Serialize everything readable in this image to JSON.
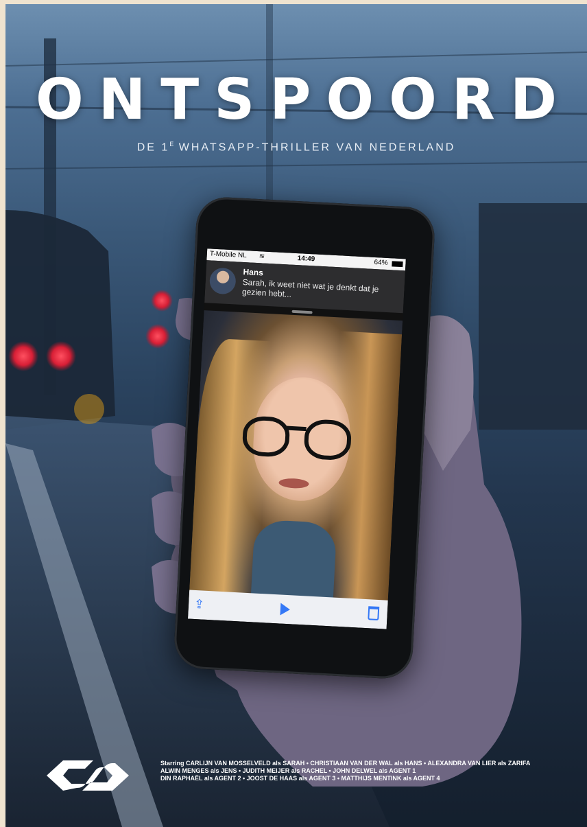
{
  "poster": {
    "title": "ONTSPOORD",
    "tagline_pre": "DE 1",
    "tagline_sup": "E",
    "tagline_post": " WHATSAPP-THRILLER VAN NEDERLAND",
    "colors": {
      "sky": "#4d6f93",
      "title": "#ffffff",
      "accent": "#3478f6",
      "signal_light": "#ff3b47"
    }
  },
  "phone": {
    "status": {
      "carrier": "T-Mobile NL",
      "time": "14:49",
      "battery": "64%"
    },
    "notification": {
      "sender": "Hans",
      "message": "Sarah, ik weet niet wat je denkt dat je gezien hebt..."
    },
    "toolbar": {
      "share_icon": "share-icon",
      "play_icon": "play-icon",
      "trash_icon": "trash-icon"
    }
  },
  "credits": {
    "line1": "Starring CARLIJN VAN MOSSELVELD als SARAH • CHRISTIAAN VAN DER WAL als HANS • ALEXANDRA VAN LIER als ZARIFA",
    "line2": "ALWIN MENGES als JENS • JUDITH MEIJER als RACHEL • JOHN DELWEL als AGENT 1",
    "line3": "DIN RAPHAËL als AGENT 2  •  JOOST DE HAAS als AGENT 3 • MATTHIJS MENTINK als AGENT 4"
  },
  "logo": {
    "name": "ns-logo"
  }
}
